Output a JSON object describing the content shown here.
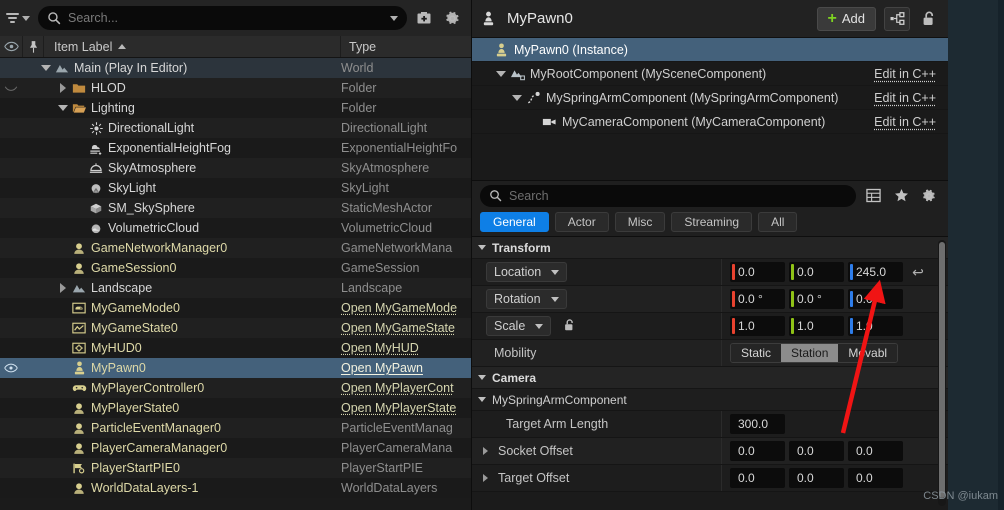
{
  "outliner": {
    "search": {
      "placeholder": "Search...",
      "value": ""
    },
    "columns": {
      "item_label": "Item Label",
      "type": "Type"
    },
    "rows": [
      {
        "label": "Main (Play In Editor)",
        "type": "World",
        "depth": 1,
        "twisty": "down",
        "icon": "landscape-icon",
        "style": "white",
        "type_style": "plain",
        "row": "world"
      },
      {
        "label": "HLOD",
        "type": "Folder",
        "depth": 2,
        "twisty": "right",
        "icon": "folder-closed-icon",
        "style": "white",
        "type_style": "plain",
        "row": "alt"
      },
      {
        "label": "Lighting",
        "type": "Folder",
        "depth": 2,
        "twisty": "down",
        "icon": "folder-open-icon",
        "style": "white",
        "type_style": "plain",
        "row": "even"
      },
      {
        "label": "DirectionalLight",
        "type": "DirectionalLight",
        "depth": 3,
        "twisty": "none",
        "icon": "directional-light-icon",
        "style": "white",
        "type_style": "plain",
        "row": "alt"
      },
      {
        "label": "ExponentialHeightFog",
        "type": "ExponentialHeightFo",
        "depth": 3,
        "twisty": "none",
        "icon": "fog-icon",
        "style": "white",
        "type_style": "plain",
        "row": "even"
      },
      {
        "label": "SkyAtmosphere",
        "type": "SkyAtmosphere",
        "depth": 3,
        "twisty": "none",
        "icon": "sky-atmosphere-icon",
        "style": "white",
        "type_style": "plain",
        "row": "alt"
      },
      {
        "label": "SkyLight",
        "type": "SkyLight",
        "depth": 3,
        "twisty": "none",
        "icon": "sky-light-icon",
        "style": "white",
        "type_style": "plain",
        "row": "even"
      },
      {
        "label": "SM_SkySphere",
        "type": "StaticMeshActor",
        "depth": 3,
        "twisty": "none",
        "icon": "static-mesh-icon",
        "style": "white",
        "type_style": "plain",
        "row": "alt"
      },
      {
        "label": "VolumetricCloud",
        "type": "VolumetricCloud",
        "depth": 3,
        "twisty": "none",
        "icon": "cloud-icon",
        "style": "white",
        "type_style": "plain",
        "row": "even"
      },
      {
        "label": "GameNetworkManager0",
        "type": "GameNetworkMana",
        "depth": 2,
        "twisty": "none",
        "icon": "actor-icon",
        "style": "gold",
        "type_style": "plain",
        "row": "alt"
      },
      {
        "label": "GameSession0",
        "type": "GameSession",
        "depth": 2,
        "twisty": "none",
        "icon": "actor-icon",
        "style": "gold",
        "type_style": "plain",
        "row": "even"
      },
      {
        "label": "Landscape",
        "type": "Landscape",
        "depth": 2,
        "twisty": "right",
        "icon": "landscape-icon",
        "style": "white",
        "type_style": "plain",
        "row": "alt"
      },
      {
        "label": "MyGameMode0",
        "type": "Open MyGameMode",
        "depth": 2,
        "twisty": "none",
        "icon": "gamemode-icon",
        "style": "gold",
        "type_style": "link",
        "row": "even"
      },
      {
        "label": "MyGameState0",
        "type": "Open MyGameState",
        "depth": 2,
        "twisty": "none",
        "icon": "gamestate-icon",
        "style": "gold",
        "type_style": "link",
        "row": "alt"
      },
      {
        "label": "MyHUD0",
        "type": "Open MyHUD",
        "depth": 2,
        "twisty": "none",
        "icon": "hud-icon",
        "style": "gold",
        "type_style": "link",
        "row": "even"
      },
      {
        "label": "MyPawn0",
        "type": "Open MyPawn",
        "depth": 2,
        "twisty": "none",
        "icon": "pawn-icon",
        "style": "gold",
        "type_style": "link",
        "row": "selected"
      },
      {
        "label": "MyPlayerController0",
        "type": "Open MyPlayerCont",
        "depth": 2,
        "twisty": "none",
        "icon": "controller-icon",
        "style": "gold",
        "type_style": "link",
        "row": "alt"
      },
      {
        "label": "MyPlayerState0",
        "type": "Open MyPlayerState",
        "depth": 2,
        "twisty": "none",
        "icon": "actor-icon",
        "style": "gold",
        "type_style": "link",
        "row": "even"
      },
      {
        "label": "ParticleEventManager0",
        "type": "ParticleEventManag",
        "depth": 2,
        "twisty": "none",
        "icon": "actor-icon",
        "style": "gold",
        "type_style": "plain",
        "row": "alt"
      },
      {
        "label": "PlayerCameraManager0",
        "type": "PlayerCameraMana",
        "depth": 2,
        "twisty": "none",
        "icon": "actor-icon",
        "style": "gold",
        "type_style": "plain",
        "row": "even"
      },
      {
        "label": "PlayerStartPIE0",
        "type": "PlayerStartPIE",
        "depth": 2,
        "twisty": "none",
        "icon": "player-start-icon",
        "style": "gold",
        "type_style": "plain",
        "row": "alt"
      },
      {
        "label": "WorldDataLayers-1",
        "type": "WorldDataLayers",
        "depth": 2,
        "twisty": "none",
        "icon": "actor-icon",
        "style": "gold",
        "type_style": "plain",
        "row": "even"
      }
    ]
  },
  "details": {
    "title": "MyPawn0",
    "add_label": "Add",
    "components": [
      {
        "label": "MyPawn0 (Instance)",
        "link": "",
        "depth": 0,
        "twisty": "none",
        "icon": "pawn-icon",
        "selected": true
      },
      {
        "label": "MyRootComponent (MySceneComponent)",
        "link": "Edit in C++",
        "depth": 1,
        "twisty": "down",
        "icon": "scene-component-icon",
        "selected": false
      },
      {
        "label": "MySpringArmComponent (MySpringArmComponent)",
        "link": "Edit in C++",
        "depth": 2,
        "twisty": "down",
        "icon": "spring-arm-icon",
        "selected": false
      },
      {
        "label": "MyCameraComponent (MyCameraComponent)",
        "link": "Edit in C++",
        "depth": 3,
        "twisty": "none",
        "icon": "camera-icon",
        "selected": false
      }
    ],
    "search": {
      "placeholder": "Search",
      "value": ""
    },
    "tabs": [
      {
        "label": "General",
        "active": true
      },
      {
        "label": "Actor",
        "active": false
      },
      {
        "label": "Misc",
        "active": false
      },
      {
        "label": "Streaming",
        "active": false
      },
      {
        "label": "All",
        "active": false
      }
    ],
    "transform": {
      "header": "Transform",
      "location": {
        "label": "Location",
        "x": "0.0",
        "y": "0.0",
        "z": "245.0"
      },
      "rotation": {
        "label": "Rotation",
        "x": "0.0 °",
        "y": "0.0 °",
        "z": "0.0 °"
      },
      "scale": {
        "label": "Scale",
        "x": "1.0",
        "y": "1.0",
        "z": "1.0"
      },
      "mobility": {
        "label": "Mobility",
        "options": [
          {
            "label": "Static",
            "active": false
          },
          {
            "label": "Station",
            "active": true
          },
          {
            "label": "Movabl",
            "active": false
          }
        ]
      }
    },
    "camera": {
      "header": "Camera",
      "subheader": "MySpringArmComponent",
      "rows": [
        {
          "label": "Target Arm Length",
          "kind": "single",
          "values": [
            "300.0"
          ]
        },
        {
          "label": "Socket Offset",
          "kind": "vector",
          "values": [
            "0.0",
            "0.0",
            "0.0"
          ]
        },
        {
          "label": "Target Offset",
          "kind": "vector",
          "values": [
            "0.0",
            "0.0",
            "0.0"
          ]
        }
      ]
    }
  },
  "axis_colors": {
    "x": "#e8422f",
    "y": "#8fc217",
    "z": "#2e7dea"
  },
  "accent_colors": {
    "selection": "#44617b",
    "tab_active": "#0e7fe6",
    "add_plus": "#7ed321",
    "annotation_arrow": "#f01414"
  },
  "watermark": "CSDN @iukam"
}
